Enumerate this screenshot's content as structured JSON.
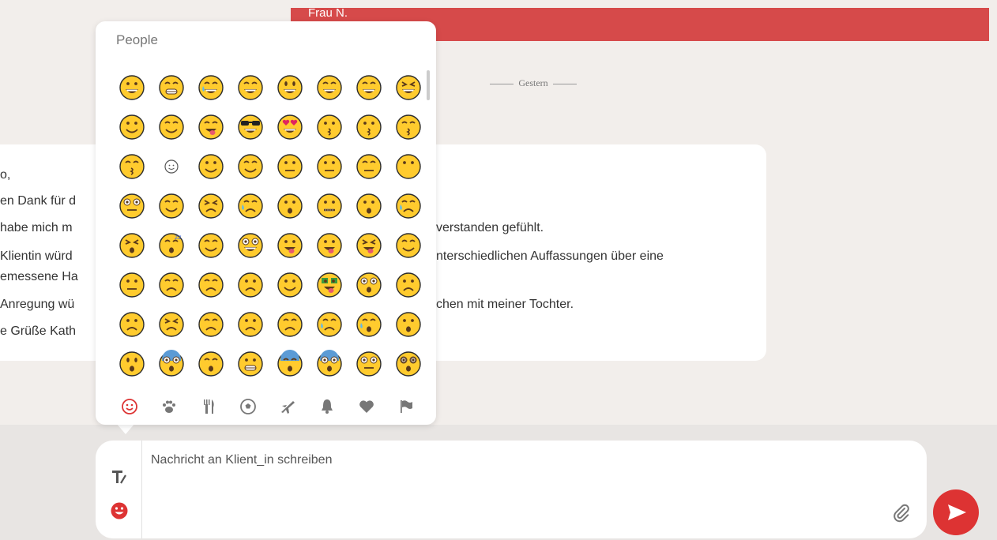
{
  "conversation": {
    "contact_name": "Frau N.",
    "date_separator": "Gestern",
    "message_left_lines": [
      "o,",
      "en Dank für d",
      "habe mich m",
      "Klientin würd",
      "emessene Ha",
      "Anregung wü",
      "e Grüße Kath"
    ],
    "message_right_lines": [
      "verstanden gefühlt.",
      "nterschiedlichen Auffassungen über eine",
      "chen mit meiner Tochter."
    ]
  },
  "emoji_picker": {
    "category_title": "People",
    "emojis": [
      "grinning",
      "grin",
      "joy",
      "rofl",
      "smiley",
      "smile",
      "sweat-smile",
      "laughing",
      "wink",
      "blush",
      "yum",
      "sunglasses",
      "heart-eyes",
      "kissing-heart",
      "kissing",
      "kissing-smiling-eyes",
      "kissing-closed-eyes",
      "relaxed",
      "slight-smile",
      "hugging",
      "thinking",
      "neutral",
      "expressionless",
      "no-mouth",
      "rolling-eyes",
      "smirk",
      "persevere",
      "disappointed-relieved",
      "open-mouth",
      "zipper-mouth",
      "hushed",
      "sleepy",
      "tired",
      "sleeping",
      "relieved",
      "nerd",
      "tongue",
      "tongue-wink",
      "tongue-closed-eyes",
      "drooling",
      "unamused",
      "sweat",
      "pensive",
      "confused",
      "upside-down",
      "money-mouth",
      "astonished",
      "frowning",
      "slight-frown",
      "confounded",
      "disappointed",
      "worried",
      "triumph",
      "cry",
      "sob",
      "frowning-open",
      "anguished",
      "fearful",
      "weary",
      "grimacing",
      "cold-sweat",
      "scream",
      "flushed",
      "dizzy"
    ],
    "categories": [
      "smiley-icon",
      "paw-icon",
      "cutlery-icon",
      "soccer-icon",
      "plane-icon",
      "bell-icon",
      "heart-icon",
      "flag-icon"
    ],
    "active_category": "smiley-icon"
  },
  "composer": {
    "placeholder": "Nachricht an Klient_in schreiben"
  },
  "colors": {
    "accent": "#d33333",
    "header": "#d64a4a",
    "emoji_yellow": "#ffcb2e"
  }
}
